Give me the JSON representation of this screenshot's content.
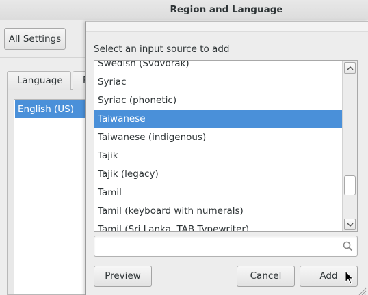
{
  "window": {
    "title": "Region and Language"
  },
  "toolbar": {
    "all_settings_label": "All Settings"
  },
  "tabs": [
    {
      "label": "Language"
    },
    {
      "label": "F"
    }
  ],
  "languages": {
    "selected": "English (US)"
  },
  "dialog": {
    "prompt": "Select an input source to add",
    "sources": [
      "Swedish (Svdvorak)",
      "Syriac",
      "Syriac (phonetic)",
      "Taiwanese",
      "Taiwanese (indigenous)",
      "Tajik",
      "Tajik (legacy)",
      "Tamil",
      "Tamil (keyboard with numerals)",
      "Tamil (Sri Lanka, TAB Typewriter)"
    ],
    "selected_source": "Taiwanese",
    "scroll_position": 0.82,
    "search": {
      "value": "",
      "placeholder": ""
    },
    "buttons": {
      "preview": "Preview",
      "cancel": "Cancel",
      "add": "Add"
    }
  },
  "colors": {
    "selection": "#4a90d9",
    "selection_text": "#ffffff"
  }
}
